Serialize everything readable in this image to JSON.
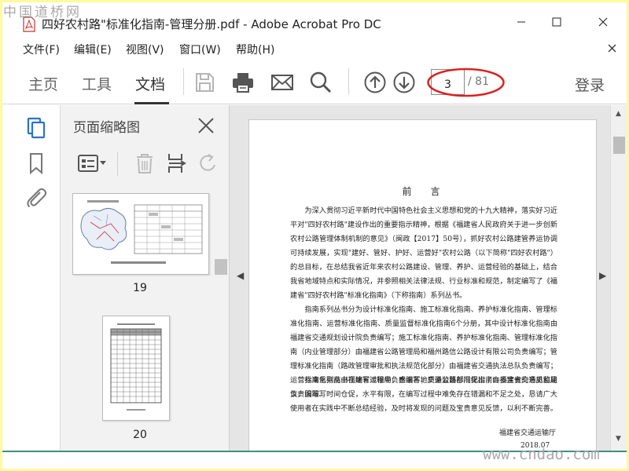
{
  "window": {
    "title": "四好农村路\"标准化指南-管理分册.pdf - Adobe Acrobat Pro DC"
  },
  "menu": {
    "items": [
      "文件(F)",
      "编辑(E)",
      "视图(V)",
      "窗口(W)",
      "帮助(H)"
    ]
  },
  "toolbar": {
    "tabs": [
      "主页",
      "工具",
      "文档"
    ],
    "active_tab": "文档",
    "current_page": "3",
    "total_pages": "/ 81",
    "login_label": "登录"
  },
  "thumbnails_panel": {
    "title": "页面缩略图",
    "thumbnails": [
      {
        "label": "19"
      },
      {
        "label": "20"
      }
    ]
  },
  "document": {
    "heading": "前　言",
    "paragraphs": [
      "为深入贯彻习近平新时代中国特色社会主义思想和党的十九大精神，落实好习近平对\"四好农村路\"建设作出的重要指示精神，根据《福建省人民政府关于进一步创新农村公路管理体制机制的意见》（闽政【2017】50号），抓好农村公路建管养运协调可持续发展，实现\"建好、管好、护好、运营好\"农村公路（以下简称\"四好农村路\"）的总目标，在总结我省近年来农村公路建设、管理、养护、运营经验的基础上，结合我省地域特点和实际情况，并参照相关法律法规、行业标准和规范，制定编写了《福建省\"四好农村路\"标准化指南》（下称指南）系列丛书。",
      "指南系列丛书分为设计标准化指南、施工标准化指南、养护标准化指南、管理标准化指南、运营标准化指南、质量监督标准化指南6个分册，其中设计标准化指南由福建省交通规划设计院负责编写；施工标准化指南、养护标准化指南、管理标准化指南（内业管理部分）由福建省公路管理局和福州路信公路设计有限公司负责编写；管理标准化指南（路政管理审批和执法规范化部分）由福建省交通执法总队负责编写；运营标准化指南由福建省运输局负责编写；质量监督标准化指南由福建省交通质监局负责编写。",
      "指南系列丛书在编写过程中，感谢各地交通公路部门提出了许多宝贵的意见和建议，因编写时间仓促，水平有限，在编写过程中难免存在错漏和不足之处，恳请广大使用者在实践中不断总结经验，及时将发现的问题及宝贵意见反馈，以利不断完善。"
    ],
    "signature": "福建省交通运输厅",
    "date": "2018.07"
  },
  "watermarks": {
    "top_left": "中国道桥网",
    "bottom_right": "www.cndao.com"
  },
  "colors": {
    "annotation_ellipse": "#d9211f",
    "highlight_background": "#fffa9c",
    "bottom_accent": "#3e8f7a",
    "app_icon_red": "#c9302c"
  },
  "icons": {
    "toolbar": [
      "save-icon",
      "print-icon",
      "email-icon",
      "search-icon",
      "page-up-icon",
      "page-down-icon"
    ],
    "left_rail": [
      "page-thumbnails-icon",
      "bookmark-icon",
      "attachment-icon"
    ],
    "panel_tools": [
      "thumbnail-options-icon",
      "delete-page-icon",
      "insert-page-icon",
      "rotate-page-icon"
    ]
  }
}
